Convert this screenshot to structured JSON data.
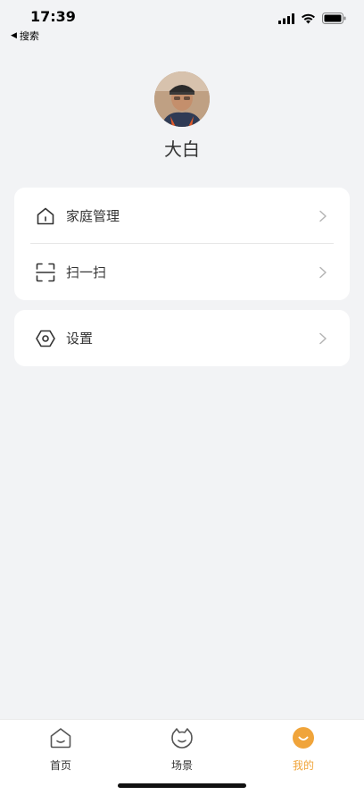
{
  "status_bar": {
    "time": "17:39",
    "back_app": "搜索"
  },
  "profile": {
    "name": "大白",
    "avatar_icon": "user-photo"
  },
  "menu_group_1": [
    {
      "label": "家庭管理",
      "icon": "home-icon"
    },
    {
      "label": "扫一扫",
      "icon": "scan-icon"
    }
  ],
  "menu_group_2": [
    {
      "label": "设置",
      "icon": "settings-icon"
    }
  ],
  "tabs": [
    {
      "label": "首页",
      "icon": "home-tab-icon",
      "active": false
    },
    {
      "label": "场景",
      "icon": "scene-tab-icon",
      "active": false
    },
    {
      "label": "我的",
      "icon": "mine-tab-icon",
      "active": true
    }
  ],
  "colors": {
    "accent": "#f0a43a",
    "background": "#f2f3f5",
    "card": "#ffffff"
  }
}
